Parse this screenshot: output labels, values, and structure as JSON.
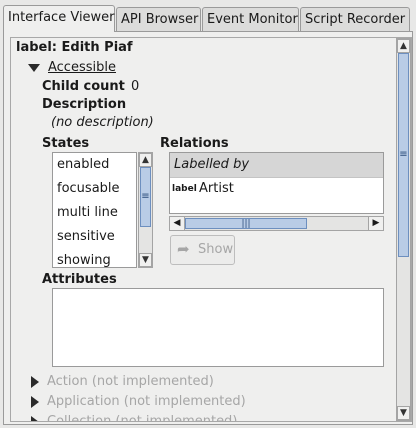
{
  "tabs": [
    {
      "label": "Interface Viewer",
      "active": true
    },
    {
      "label": "API Browser",
      "active": false
    },
    {
      "label": "Event Monitor",
      "active": false
    },
    {
      "label": "Script Recorder",
      "active": false
    }
  ],
  "header": {
    "title": "label: Edith Piaf"
  },
  "accessible": {
    "section_label": "Accessible",
    "child_count_label": "Child count",
    "child_count_value": "0",
    "description_label": "Description",
    "description_value": "(no description)"
  },
  "states": {
    "label": "States",
    "items": [
      "enabled",
      "focusable",
      "multi line",
      "sensitive",
      "showing"
    ]
  },
  "relations": {
    "label": "Relations",
    "group_header": "Labelled by",
    "items": [
      {
        "role": "label",
        "name": "Artist"
      }
    ],
    "show_button": "Show"
  },
  "attributes": {
    "label": "Attributes"
  },
  "collapsed_sections": [
    "Action (not implemented)",
    "Application (not implemented)",
    "Collection (not implemented)"
  ],
  "colors": {
    "selected_header_bg": "#d6d6d6",
    "scroll_thumb": "#b9cce6"
  }
}
